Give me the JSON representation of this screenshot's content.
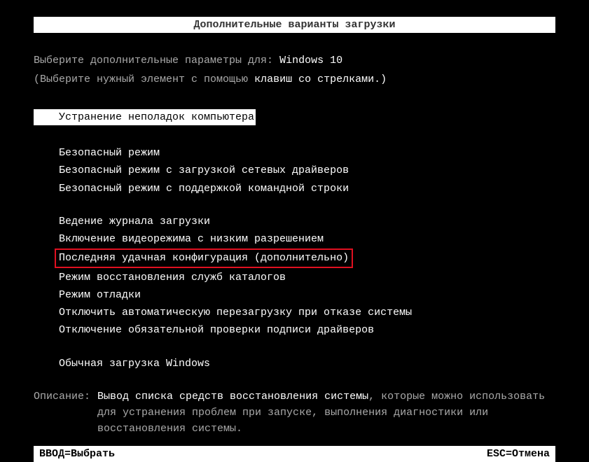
{
  "title": "Дополнительные варианты загрузки",
  "prompt": {
    "line1_prefix": "Выберите дополнительные параметры для: ",
    "line1_target": "Windows 10",
    "line2_prefix": "(Выберите нужный элемент с помощью ",
    "line2_hint": "клавиш со стрелками.)"
  },
  "selected_item": "Устранение неполадок компьютера",
  "menu": {
    "group1": [
      "Безопасный режим",
      "Безопасный режим с загрузкой сетевых драйверов",
      "Безопасный режим с поддержкой командной строки"
    ],
    "group2": [
      "Ведение журнала загрузки",
      "Включение видеорежима с низким разрешением",
      "Последняя удачная конфигурация (дополнительно)",
      "Режим восстановления служб каталогов",
      "Режим отладки",
      "Отключить автоматическую перезагрузку при отказе системы",
      "Отключение обязательной проверки подписи драйверов"
    ],
    "group3": [
      "Обычная загрузка Windows"
    ],
    "highlighted_index_global": 5
  },
  "description": {
    "label": "Описание:",
    "text_part1": "Вывод списка средств восстановления системы",
    "text_part2": ", которые можно использовать для устранения проблем при запуске, выполнения диагностики или восстановления системы."
  },
  "footer": {
    "enter": "ВВОД=Выбрать",
    "esc": "ESC=Отмена"
  }
}
